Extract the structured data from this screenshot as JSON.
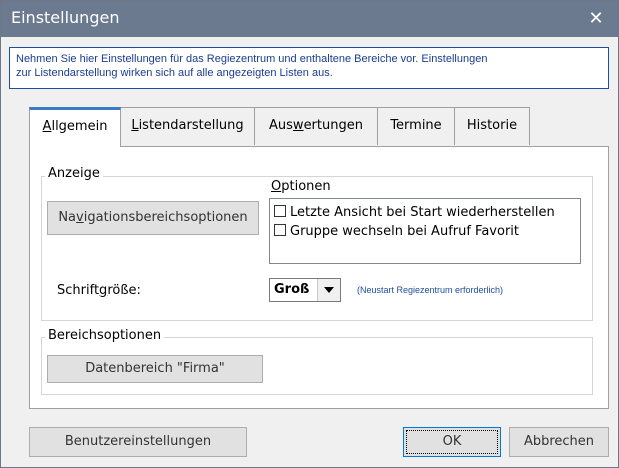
{
  "window": {
    "title": "Einstellungen",
    "close_glyph": "✕"
  },
  "info": {
    "line1": "Nehmen Sie hier Einstellungen für das Regiezentrum und enthaltene Bereiche vor. Einstellungen",
    "line2": "zur Listendarstellung wirken sich auf alle angezeigten Listen aus."
  },
  "tabs": [
    {
      "pre": "",
      "mn": "A",
      "post": "llgemein",
      "active": true
    },
    {
      "pre": "",
      "mn": "L",
      "post": "istendarstellung",
      "active": false
    },
    {
      "pre": "Aus",
      "mn": "w",
      "post": "ertungen",
      "active": false
    },
    {
      "pre": "Termine",
      "mn": "",
      "post": "",
      "active": false
    },
    {
      "pre": "Historie",
      "mn": "",
      "post": "",
      "active": false
    }
  ],
  "anzeige": {
    "label": "Anzeige",
    "nav_button": {
      "pre": "Na",
      "mn": "v",
      "post": "igationsbereichsoptionen"
    },
    "optionen": {
      "pre": "",
      "mn": "O",
      "post": "ptionen"
    },
    "options": [
      {
        "label": "Letzte Ansicht bei Start wiederherstellen",
        "checked": false
      },
      {
        "label": "Gruppe wechseln bei Aufruf Favorit",
        "checked": false
      }
    ],
    "font_size": {
      "pre": "Schrift",
      "mn": "g",
      "post": "röße:",
      "value": "Groß",
      "hint": "(Neustart Regiezentrum erforderlich)"
    }
  },
  "bereich": {
    "label": "Bereichsoptionen",
    "button": "Datenbereich \"Firma\""
  },
  "footer": {
    "user_settings": "Benutzereinstellungen",
    "ok": "OK",
    "cancel": "Abbrechen"
  },
  "colors": {
    "titlebar": "#6b7a8f",
    "tab_accent": "#3b79c9",
    "info_text": "#1a3d8f"
  }
}
